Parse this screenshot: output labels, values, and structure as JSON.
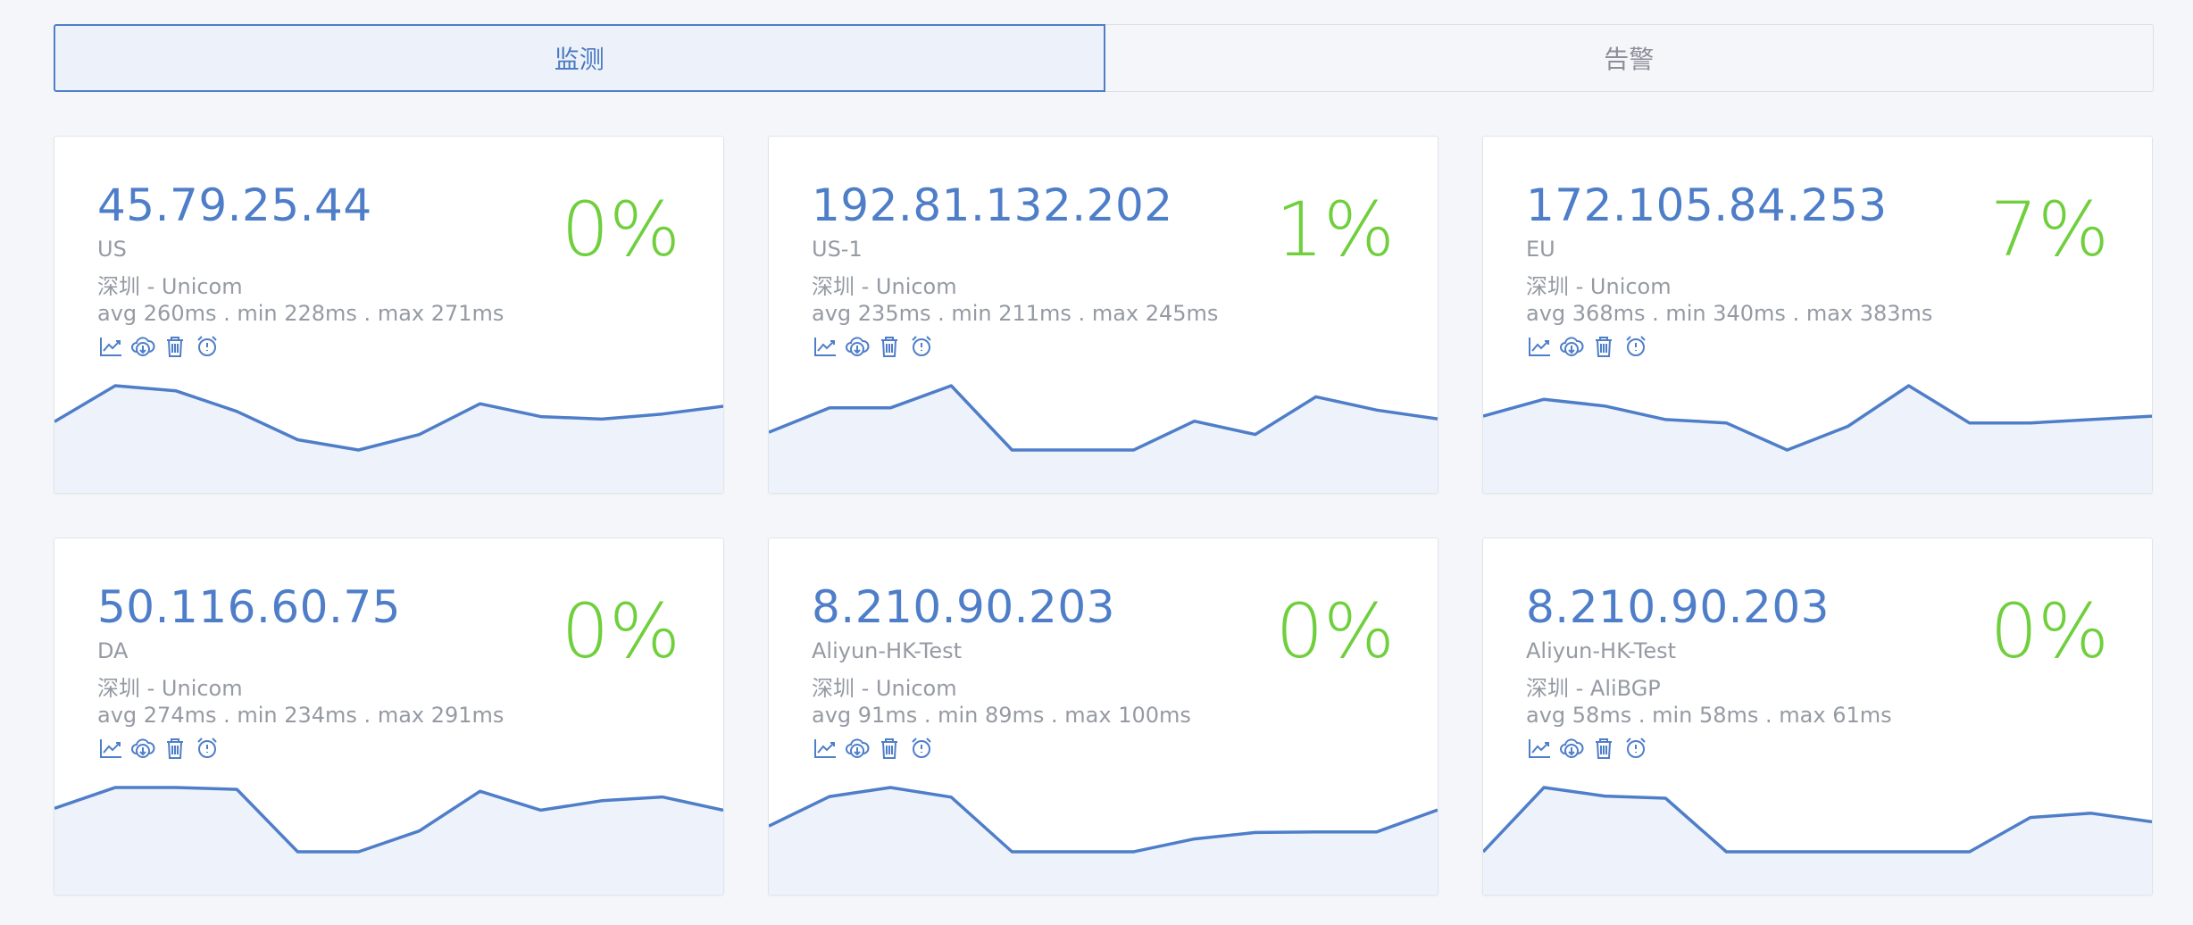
{
  "tabs": [
    {
      "label": "监测",
      "active": true
    },
    {
      "label": "告警",
      "active": false
    }
  ],
  "colors": {
    "accent": "#4f7ec9",
    "success": "#6fcf3c",
    "muted": "#959aa3",
    "fill": "#eef2fa"
  },
  "icons": [
    "chart-icon",
    "download-icon",
    "delete-icon",
    "alarm-icon"
  ],
  "cards": [
    {
      "ip": "45.79.25.44",
      "name": "US",
      "location": "深圳 - Unicom",
      "stats": "avg 260ms . min 228ms . max 271ms",
      "loss": "0%",
      "series": [
        256,
        270,
        268,
        260,
        249,
        245,
        251,
        263,
        258,
        257,
        259,
        262
      ]
    },
    {
      "ip": "192.81.132.202",
      "name": "US-1",
      "location": "深圳 - Unicom",
      "stats": "avg 235ms . min 211ms . max 245ms",
      "loss": "1%",
      "series": [
        222,
        233,
        233,
        243,
        214,
        214,
        214,
        227,
        221,
        238,
        232,
        228
      ]
    },
    {
      "ip": "172.105.84.253",
      "name": "EU",
      "location": "深圳 - Unicom",
      "stats": "avg 368ms . min 340ms . max 383ms",
      "loss": "7%",
      "series": [
        370,
        375,
        373,
        369,
        368,
        360,
        367,
        379,
        368,
        368,
        369,
        370
      ]
    },
    {
      "ip": "50.116.60.75",
      "name": "DA",
      "location": "深圳 - Unicom",
      "stats": "avg 274ms . min 234ms . max 291ms",
      "loss": "0%",
      "series": [
        277,
        288,
        288,
        287,
        254,
        254,
        265,
        286,
        276,
        281,
        283,
        276
      ]
    },
    {
      "ip": "8.210.90.203",
      "name": "Aliyun-HK-Test",
      "location": "深圳 - Unicom",
      "stats": "avg 91ms . min 89ms . max 100ms",
      "loss": "0%",
      "series": [
        93,
        97.6,
        99,
        97.5,
        89,
        89,
        89,
        91,
        92,
        92.1,
        92.1,
        95.5
      ]
    },
    {
      "ip": "8.210.90.203",
      "name": "Aliyun-HK-Test",
      "location": "深圳 - AliBGP",
      "stats": "avg 58ms . min 58ms . max 61ms",
      "loss": "0%",
      "series": [
        58,
        61,
        60.6,
        60.5,
        58,
        58,
        58,
        58,
        58,
        59.6,
        59.8,
        59.4
      ]
    }
  ]
}
